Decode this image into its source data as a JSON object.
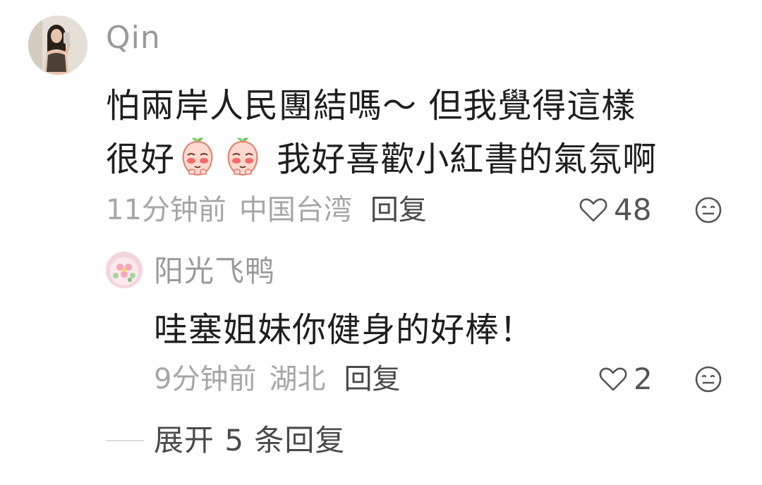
{
  "comment": {
    "username": "Qin",
    "avatar_icon": "user-avatar-photo",
    "text_line1": "怕兩岸人民團結嗎～ 但我覺得這樣",
    "text_line2_before": "很好",
    "text_line2_after": " 我好喜歡小紅書的氣氛啊",
    "emoji_name": "blushing-peach-emoji",
    "time": "11分钟前",
    "location": "中国台湾",
    "reply_label": "回复",
    "like_count": "48",
    "like_icon": "heart-outline-icon",
    "emoji_react_icon": "neutral-face-icon"
  },
  "reply": {
    "username": "阳光飞鸭",
    "avatar_icon": "flower-avatar",
    "text": "哇塞姐妹你健身的好棒！",
    "time": "9分钟前",
    "location": "湖北",
    "reply_label": "回复",
    "like_count": "2",
    "like_icon": "heart-outline-icon",
    "emoji_react_icon": "neutral-face-icon"
  },
  "expand": {
    "label": "展开 5 条回复"
  },
  "colors": {
    "username": "#9a9a9a",
    "text": "#1e1e1e",
    "meta": "#a6a6a6",
    "reply_link": "#4a4a4a"
  }
}
